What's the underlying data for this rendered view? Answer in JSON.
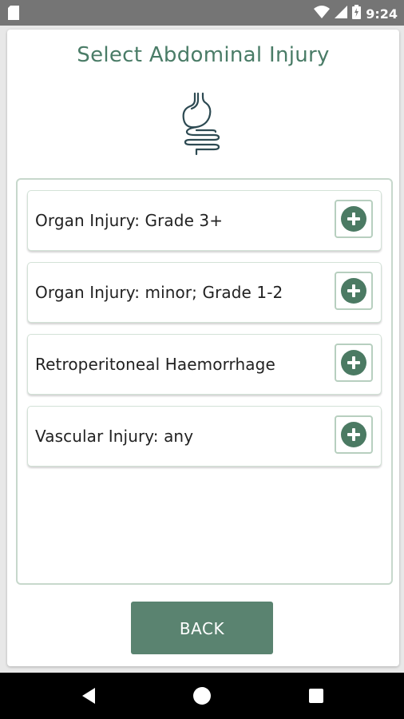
{
  "status_bar": {
    "time": "9:24",
    "icons": [
      "sd-card-icon",
      "wifi-icon",
      "signal-icon",
      "battery-charging-icon"
    ]
  },
  "page": {
    "title": "Select Abdominal Injury",
    "header_icon": "stomach-icon"
  },
  "injuries": [
    {
      "label": "Organ Injury: Grade 3+"
    },
    {
      "label": "Organ Injury: minor; Grade 1-2"
    },
    {
      "label": "Retroperitoneal Haemorrhage"
    },
    {
      "label": "Vascular Injury: any"
    }
  ],
  "footer": {
    "back_label": "BACK"
  },
  "colors": {
    "accent": "#4a7c67",
    "button_bg": "#5a8370",
    "plus_bg": "#4b7a63",
    "border": "#c7d8cc"
  }
}
